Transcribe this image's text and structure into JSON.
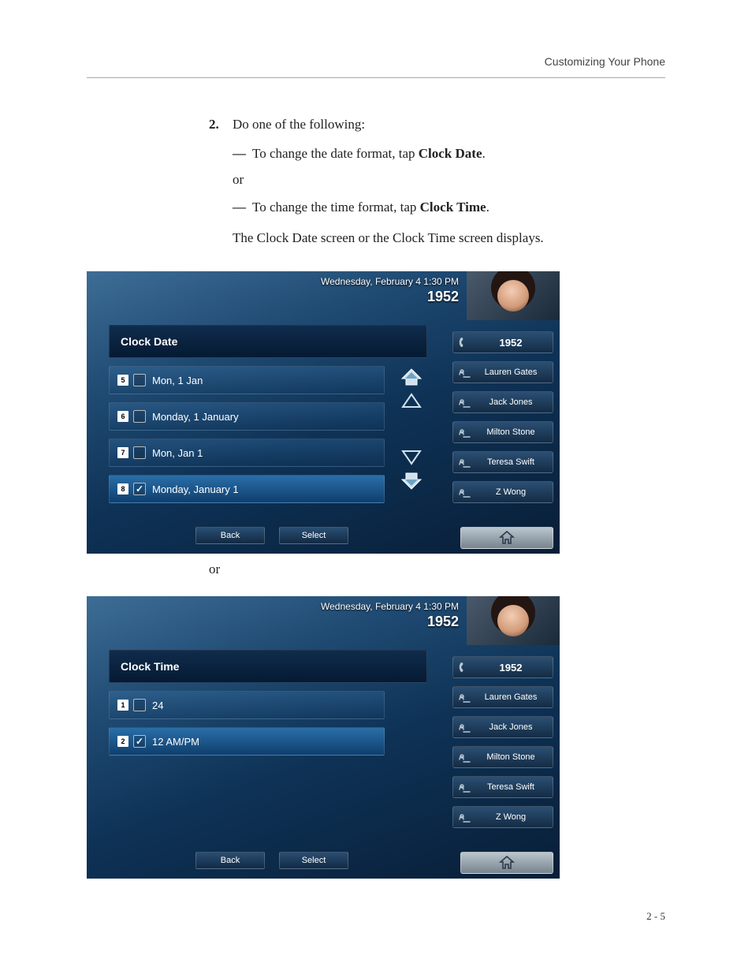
{
  "page": {
    "header": "Customizing Your Phone",
    "footer": "2 - 5"
  },
  "step": {
    "number": "2.",
    "intro": "Do one of the following:",
    "dash": "—",
    "option1_prefix": "To change the date format, tap ",
    "option1_bold": "Clock Date",
    "option1_suffix": ".",
    "or": "or",
    "option2_prefix": "To change the time format, tap ",
    "option2_bold": "Clock Time",
    "option2_suffix": ".",
    "result": "The Clock Date screen or the Clock Time screen displays."
  },
  "between_or": "or",
  "shot_common": {
    "status_date": "Wednesday, February 4  1:30 PM",
    "status_ext": "1952",
    "back": "Back",
    "select": "Select"
  },
  "sidebar": {
    "ext": "1952",
    "contacts": [
      "Lauren Gates",
      "Jack Jones",
      "Milton Stone",
      "Teresa Swift",
      "Z Wong"
    ]
  },
  "shot1": {
    "title": "Clock Date",
    "items": [
      {
        "num": "5",
        "label": "Mon, 1 Jan",
        "checked": false
      },
      {
        "num": "6",
        "label": "Monday, 1 January",
        "checked": false
      },
      {
        "num": "7",
        "label": "Mon, Jan 1",
        "checked": false
      },
      {
        "num": "8",
        "label": "Monday, January 1",
        "checked": true
      }
    ]
  },
  "shot2": {
    "title": "Clock Time",
    "items": [
      {
        "num": "1",
        "label": "24",
        "checked": false
      },
      {
        "num": "2",
        "label": "12 AM/PM",
        "checked": true
      }
    ]
  }
}
